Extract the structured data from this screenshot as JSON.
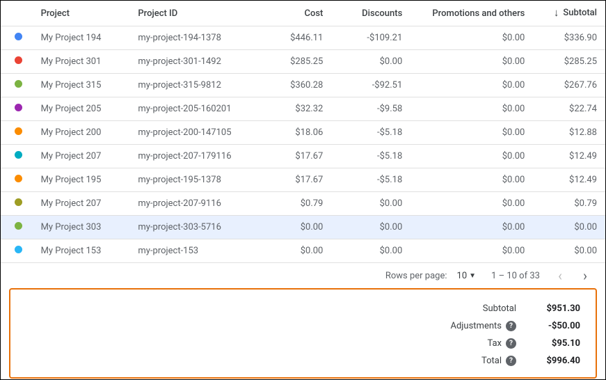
{
  "headers": {
    "project": "Project",
    "project_id": "Project ID",
    "cost": "Cost",
    "discounts": "Discounts",
    "promotions": "Promotions and others",
    "subtotal": "Subtotal"
  },
  "rows": [
    {
      "color": "#4285f4",
      "project": "My Project 194",
      "pid": "my-project-194-1378",
      "cost": "$446.11",
      "discounts": "-$109.21",
      "promo": "$0.00",
      "subtotal": "$336.90",
      "highlight": false
    },
    {
      "color": "#ea4335",
      "project": "My Project 301",
      "pid": "my-project-301-1492",
      "cost": "$285.25",
      "discounts": "$0.00",
      "promo": "$0.00",
      "subtotal": "$285.25",
      "highlight": false
    },
    {
      "color": "#7cb342",
      "project": "My Project 315",
      "pid": "my-project-315-9812",
      "cost": "$360.28",
      "discounts": "-$92.51",
      "promo": "$0.00",
      "subtotal": "$267.76",
      "highlight": false
    },
    {
      "color": "#9c27b0",
      "project": "My Project 205",
      "pid": "my-project-205-160201",
      "cost": "$32.32",
      "discounts": "-$9.58",
      "promo": "$0.00",
      "subtotal": "$22.74",
      "highlight": false
    },
    {
      "color": "#fb8c00",
      "project": "My Project 200",
      "pid": "my-project-200-147105",
      "cost": "$18.06",
      "discounts": "-$5.18",
      "promo": "$0.00",
      "subtotal": "$12.88",
      "highlight": false
    },
    {
      "color": "#00acc1",
      "project": "My Project 207",
      "pid": "my-project-207-179116",
      "cost": "$17.67",
      "discounts": "-$5.18",
      "promo": "$0.00",
      "subtotal": "$12.49",
      "highlight": false
    },
    {
      "color": "#fb8c00",
      "project": "My Project 195",
      "pid": "my-project-195-1378",
      "cost": "$17.67",
      "discounts": "-$5.18",
      "promo": "$0.00",
      "subtotal": "$12.49",
      "highlight": false
    },
    {
      "color": "#9e9d24",
      "project": "My Project 207",
      "pid": "my-project-207-9116",
      "cost": "$0.79",
      "discounts": "$0.00",
      "promo": "$0.00",
      "subtotal": "$0.79",
      "highlight": false
    },
    {
      "color": "#7cb342",
      "project": "My Project 303",
      "pid": "my-project-303-5716",
      "cost": "$0.00",
      "discounts": "$0.00",
      "promo": "$0.00",
      "subtotal": "$0.00",
      "highlight": true
    },
    {
      "color": "#29b6f6",
      "project": "My Project 153",
      "pid": "my-project-153",
      "cost": "$0.00",
      "discounts": "$0.00",
      "promo": "$0.00",
      "subtotal": "$0.00",
      "highlight": false
    }
  ],
  "pagination": {
    "rows_per_page_label": "Rows per page:",
    "rows_per_page_value": "10",
    "range": "1 – 10 of 33"
  },
  "summary": {
    "subtotal_label": "Subtotal",
    "subtotal_value": "$951.30",
    "adjustments_label": "Adjustments",
    "adjustments_value": "-$50.00",
    "tax_label": "Tax",
    "tax_value": "$95.10",
    "total_label": "Total",
    "total_value": "$996.40"
  }
}
